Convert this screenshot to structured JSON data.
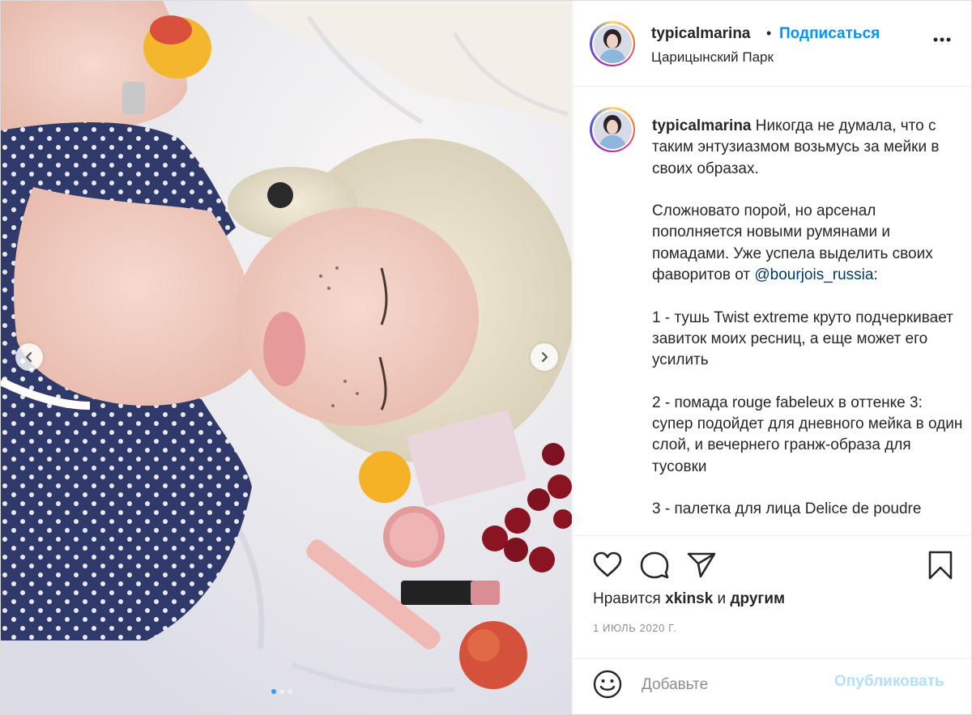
{
  "post": {
    "username": "typicalmarina",
    "bullet": "•",
    "follow_label": "Подписаться",
    "location": "Царицынский Парк",
    "caption_intro": " Никогда не думала, что с таким энтузиазмом возьмусь за мейки в своих образах.\n\nСложновато порой, но арсенал пополняется новыми румянами и помадами. Уже успела выделить своих фаворитов от ",
    "mention": "@bourjois_russia",
    "caption_rest": ":\n\n1 - тушь Twist extreme круто подчеркивает завиток моих ресниц, а еще может его усилить\n\n2 - помада rouge fabeleux в оттенке 3: супер подойдет для дневного мейка в один слой, и вечернего гранж-образа для тусовки\n\n3 - палетка для лица Delice de poudre",
    "likes_prefix": "Нравится ",
    "likes_user": "xkinsk",
    "likes_and": " и ",
    "likes_others": "другим",
    "date": "1 ИЮЛЬ 2020 Г.",
    "comment_placeholder": "Добавьте",
    "publish_label": "Опубликовать"
  },
  "carousel": {
    "slide_count": 3,
    "active_index": 0
  },
  "icons": {
    "more": "more-horizontal-icon",
    "like": "heart-icon",
    "comment": "comment-icon",
    "share": "paper-plane-icon",
    "save": "bookmark-icon",
    "emoji": "smiley-icon",
    "prev": "chevron-left-icon",
    "next": "chevron-right-icon"
  },
  "colors": {
    "accent": "#0095f6",
    "publish_disabled": "#b2dffc",
    "mention": "#00376b",
    "meta_grey": "#8e8e8e"
  }
}
